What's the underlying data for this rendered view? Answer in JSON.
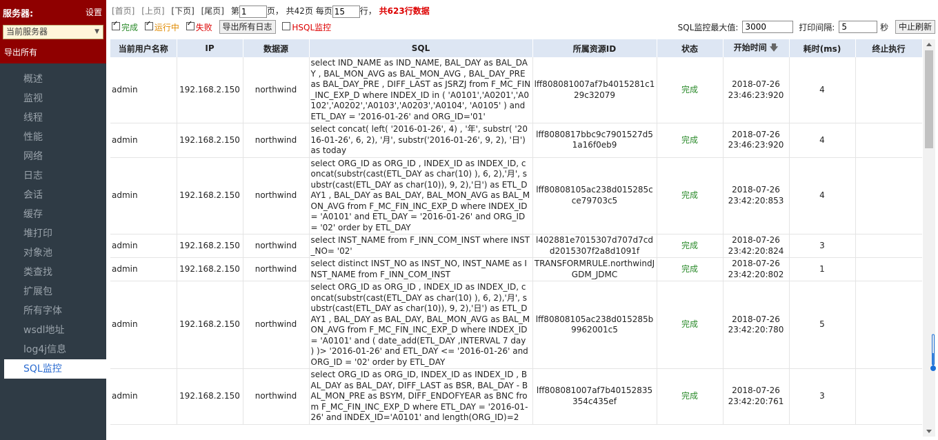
{
  "sidebar": {
    "title": "服务器:",
    "settings": "设置",
    "server_select": "当前服务器",
    "export_all": "导出所有",
    "nav": [
      "概述",
      "监视",
      "线程",
      "性能",
      "网络",
      "日志",
      "会话",
      "缓存",
      "堆打印",
      "对象池",
      "类查找",
      "扩展包",
      "所有字体",
      "wsdl地址",
      "log4j信息",
      "SQL监控"
    ],
    "active_index": 15
  },
  "pager": {
    "first": "[首页]",
    "prev": "[上页]",
    "next": "[下页]",
    "last": "[尾页]",
    "page_prefix": "第",
    "page_value": "1",
    "page_suffix": "页，",
    "total_pages": "共42页",
    "per_page_label": "每页",
    "per_page_value": "15",
    "rows_suffix": "行，",
    "total_rows": "共623行数据"
  },
  "toolbar": {
    "done_label": "完成",
    "running_label": "运行中",
    "failed_label": "失败",
    "export_logs": "导出所有日志",
    "hsql_label": "HSQL监控",
    "max_label": "SQL监控最大值:",
    "max_value": "3000",
    "interval_label": "打印间隔:",
    "interval_value": "5",
    "interval_unit": "秒",
    "stop_refresh": "中止刷新"
  },
  "table": {
    "headers": [
      "当前用户名称",
      "IP",
      "数据源",
      "SQL",
      "所属资源ID",
      "状态",
      "开始时间",
      "耗时(ms)",
      "终止执行"
    ],
    "rows": [
      {
        "user": "admin",
        "ip": "192.168.2.150",
        "ds": "northwind",
        "sql": "select IND_NAME as IND_NAME, BAL_DAY as BAL_DAY , BAL_MON_AVG as BAL_MON_AVG , BAL_DAY_PRE as BAL_DAY_PRE , DIFF_LAST as JSRZJ from F_MC_FIN_INC_EXP_D where INDEX_ID in ( 'A0101','A0201','A0102','A0202','A0103','A0203','A0104', 'A0105' ) and ETL_DAY = '2016-01-26' and ORG_ID='01'",
        "res": "lff808081007af7b4015281c129c32079",
        "status": "完成",
        "time1": "2018-07-26",
        "time2": "23:46:23:920",
        "cost": "4"
      },
      {
        "user": "admin",
        "ip": "192.168.2.150",
        "ds": "northwind",
        "sql": "select concat( left( '2016-01-26', 4) , '年', substr( '2016-01-26', 6, 2), '月', substr('2016-01-26', 9, 2), '日') as today",
        "res": "lff8080817bbc9c7901527d51a16f0eb9",
        "status": "完成",
        "time1": "2018-07-26",
        "time2": "23:46:23:920",
        "cost": "4"
      },
      {
        "user": "admin",
        "ip": "192.168.2.150",
        "ds": "northwind",
        "sql": "select ORG_ID as ORG_ID , INDEX_ID as INDEX_ID, concat(substr(cast(ETL_DAY as char(10) ), 6, 2),'月', substr(cast(ETL_DAY as char(10)), 9, 2),'日') as ETL_DAY1 , BAL_DAY as BAL_DAY, BAL_MON_AVG as BAL_MON_AVG from F_MC_FIN_INC_EXP_D where INDEX_ID = 'A0101' and ETL_DAY = '2016-01-26' and ORG_ID = '02' order by ETL_DAY",
        "res": "lff80808105ac238d015285cce79703c5",
        "status": "完成",
        "time1": "2018-07-26",
        "time2": "23:42:20:853",
        "cost": "4"
      },
      {
        "user": "admin",
        "ip": "192.168.2.150",
        "ds": "northwind",
        "sql": "select INST_NAME from F_INN_COM_INST where INST_NO= '02'",
        "res": "l402881e7015307d707d7cdd2015307f2a8d1091f",
        "status": "完成",
        "time1": "2018-07-26",
        "time2": "23:42:20:824",
        "cost": "3"
      },
      {
        "user": "admin",
        "ip": "192.168.2.150",
        "ds": "northwind",
        "sql": "select distinct INST_NO as INST_NO, INST_NAME as INST_NAME from F_INN_COM_INST",
        "res": "TRANSFORMRULE.northwindJGDM_JDMC",
        "status": "完成",
        "time1": "2018-07-26",
        "time2": "23:42:20:802",
        "cost": "1"
      },
      {
        "user": "admin",
        "ip": "192.168.2.150",
        "ds": "northwind",
        "sql": "select ORG_ID as ORG_ID , INDEX_ID as INDEX_ID, concat(substr(cast(ETL_DAY as char(10) ), 6, 2),'月', substr(cast(ETL_DAY as char(10)), 9, 2),'日') as ETL_DAY1 , BAL_DAY as BAL_DAY, BAL_MON_AVG as BAL_MON_AVG from F_MC_FIN_INC_EXP_D where INDEX_ID = 'A0101' and ( date_add(ETL_DAY ,INTERVAL 7 day ) )> '2016-01-26' and ETL_DAY <= '2016-01-26' and ORG_ID = '02' order by ETL_DAY",
        "res": "lff80808105ac238d015285b9962001c5",
        "status": "完成",
        "time1": "2018-07-26",
        "time2": "23:42:20:780",
        "cost": "5"
      },
      {
        "user": "admin",
        "ip": "192.168.2.150",
        "ds": "northwind",
        "sql": "select ORG_ID as ORG_ID, INDEX_ID as INDEX_ID , BAL_DAY as BAL_DAY, DIFF_LAST as BSR, BAL_DAY - BAL_MON_PRE as BSYM, DIFF_ENDOFYEAR as BNC from F_MC_FIN_INC_EXP_D where ETL_DAY = '2016-01-26' and INDEX_ID='A0101' and length(ORG_ID)=2",
        "res": "lff808081007af7b40152835354c435ef",
        "status": "完成",
        "time1": "2018-07-26",
        "time2": "23:42:20:761",
        "cost": "3"
      }
    ]
  }
}
